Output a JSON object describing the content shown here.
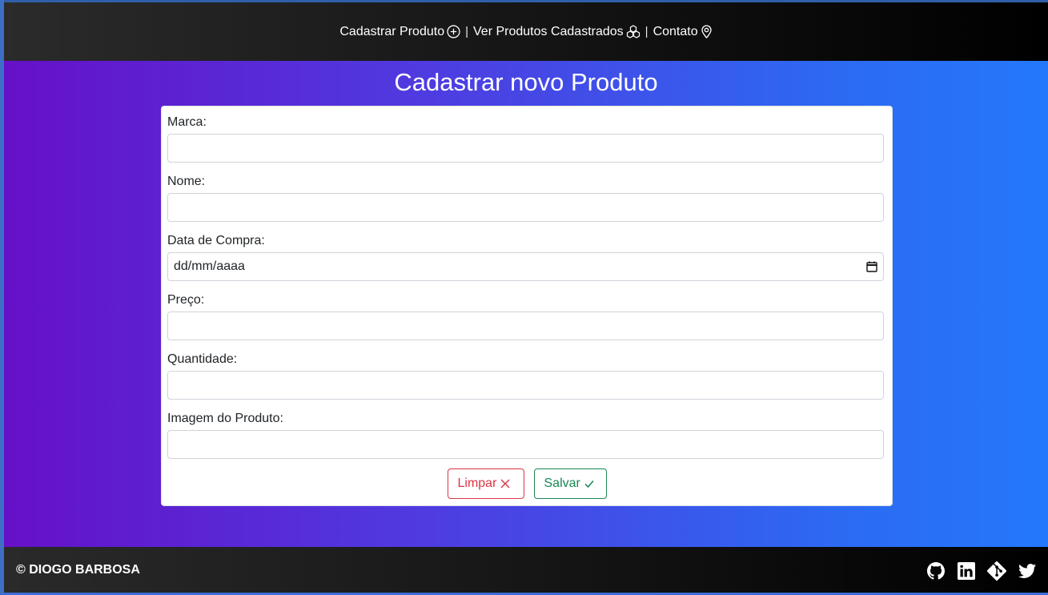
{
  "navbar": {
    "links": [
      {
        "label": "Cadastrar Produto",
        "icon": "plus-circle-icon"
      },
      {
        "label": "Ver Produtos Cadastrados",
        "icon": "boxes-icon"
      },
      {
        "label": "Contato",
        "icon": "geo-alt-icon"
      }
    ],
    "separator": "|"
  },
  "page": {
    "title": "Cadastrar novo Produto"
  },
  "form": {
    "fields": [
      {
        "label": "Marca:",
        "value": ""
      },
      {
        "label": "Nome:",
        "value": ""
      },
      {
        "label": "Data de Compra:",
        "value": "dd/mm/aaaa",
        "icon": "calendar-icon"
      },
      {
        "label": "Preço:",
        "value": ""
      },
      {
        "label": "Quantidade:",
        "value": ""
      },
      {
        "label": "Imagem do Produto:",
        "value": ""
      }
    ],
    "buttons": {
      "clear": {
        "label": "Limpar",
        "icon": "x-icon",
        "color": "#dc3545"
      },
      "save": {
        "label": "Salvar",
        "icon": "check-icon",
        "color": "#198754"
      }
    }
  },
  "footer": {
    "copyright": "© DIOGO BARBOSA",
    "social": [
      "github-icon",
      "linkedin-icon",
      "git-icon",
      "twitter-icon"
    ]
  },
  "colors": {
    "gradient_start": "#6610c8",
    "gradient_end": "#2478fb",
    "navbar_bg": "#151515"
  }
}
